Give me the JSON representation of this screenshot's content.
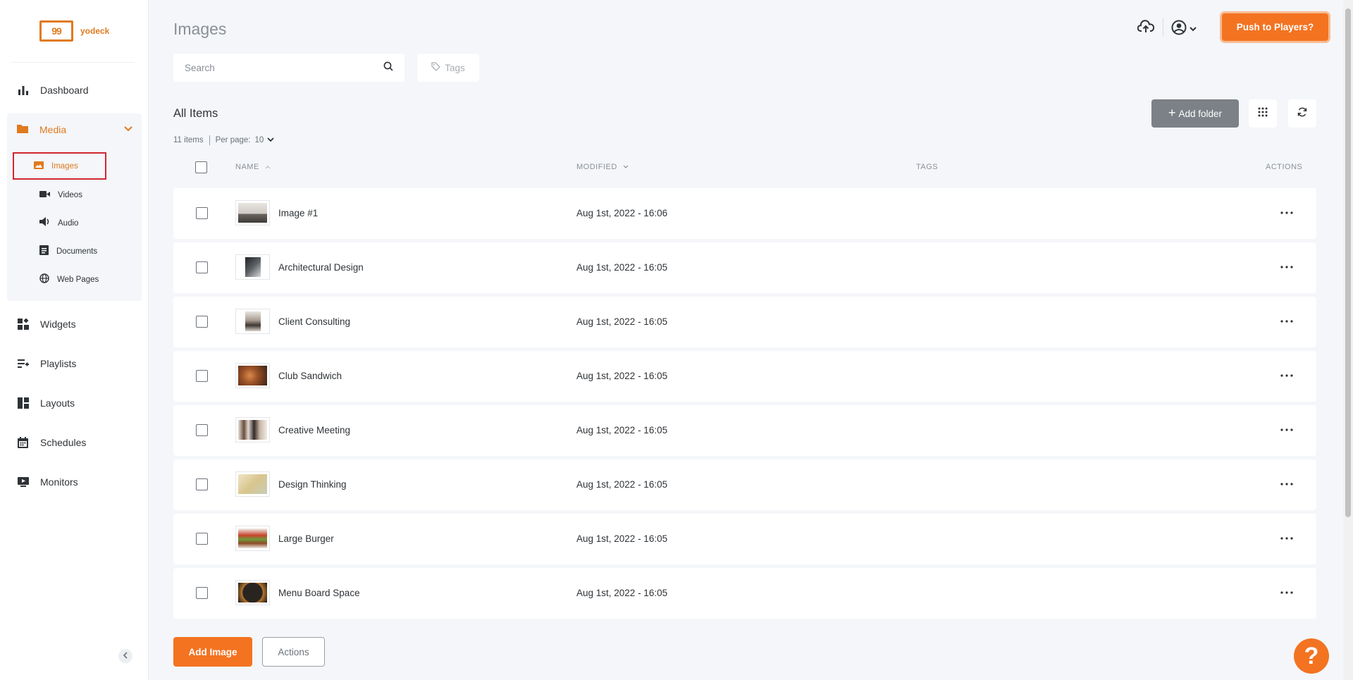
{
  "brand": {
    "logo_mark": "99",
    "logo_text": "yodeck",
    "accent": "#f37321"
  },
  "sidebar": {
    "items": [
      {
        "label": "Dashboard",
        "icon": "bar-chart-icon"
      },
      {
        "label": "Media",
        "icon": "folder-icon"
      },
      {
        "label": "Widgets",
        "icon": "widgets-icon"
      },
      {
        "label": "Playlists",
        "icon": "playlist-add-icon"
      },
      {
        "label": "Layouts",
        "icon": "layout-icon"
      },
      {
        "label": "Schedules",
        "icon": "calendar-icon"
      },
      {
        "label": "Monitors",
        "icon": "monitor-play-icon"
      }
    ],
    "media_sub": [
      {
        "label": "Images",
        "icon": "image-icon",
        "active": true
      },
      {
        "label": "Videos",
        "icon": "video-camera-icon"
      },
      {
        "label": "Audio",
        "icon": "speaker-icon"
      },
      {
        "label": "Documents",
        "icon": "document-icon"
      },
      {
        "label": "Web Pages",
        "icon": "globe-icon"
      }
    ]
  },
  "header": {
    "title": "Images",
    "push_label": "Push to Players?"
  },
  "search": {
    "placeholder": "Search"
  },
  "tags_button": "Tags",
  "list": {
    "title": "All Items",
    "count": "11 items",
    "per_page_label": "Per page:",
    "per_page_value": "10",
    "add_folder_label": "Add folder",
    "columns": {
      "name": "NAME",
      "modified": "MODIFIED",
      "tags": "TAGS",
      "actions": "ACTIONS"
    },
    "rows": [
      {
        "name": "Image #1",
        "modified": "Aug 1st, 2022 - 16:06"
      },
      {
        "name": "Architectural Design",
        "modified": "Aug 1st, 2022 - 16:05"
      },
      {
        "name": "Client Consulting",
        "modified": "Aug 1st, 2022 - 16:05"
      },
      {
        "name": "Club Sandwich",
        "modified": "Aug 1st, 2022 - 16:05"
      },
      {
        "name": "Creative Meeting",
        "modified": "Aug 1st, 2022 - 16:05"
      },
      {
        "name": "Design Thinking",
        "modified": "Aug 1st, 2022 - 16:05"
      },
      {
        "name": "Large Burger",
        "modified": "Aug 1st, 2022 - 16:05"
      },
      {
        "name": "Menu Board Space",
        "modified": "Aug 1st, 2022 - 16:05"
      }
    ]
  },
  "footer": {
    "add_image_label": "Add Image",
    "actions_label": "Actions"
  },
  "help_label": "?"
}
